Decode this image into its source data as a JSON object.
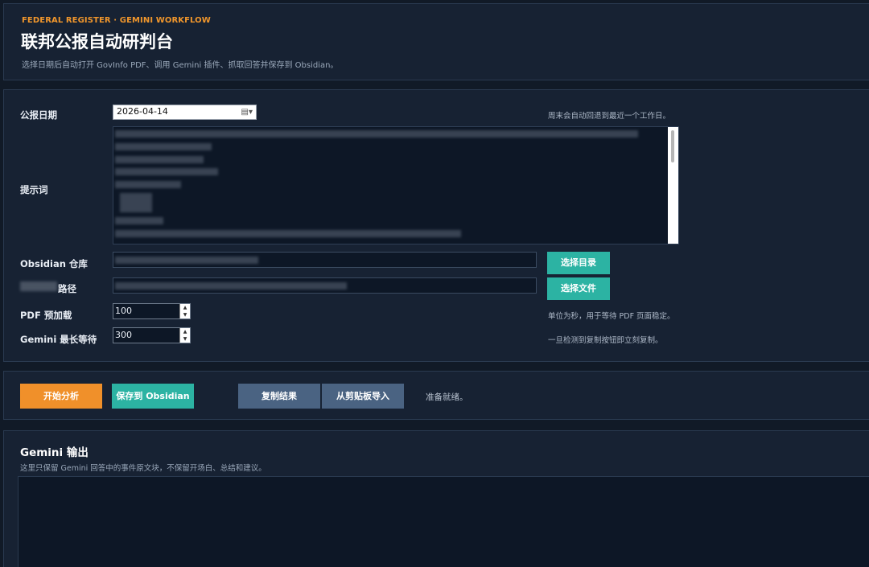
{
  "header": {
    "eyebrow": "FEDERAL REGISTER · GEMINI WORKFLOW",
    "title": "联邦公报自动研判台",
    "subtitle": "选择日期后自动打开 GovInfo PDF、调用 Gemini 插件、抓取回答并保存到 Obsidian。"
  },
  "form": {
    "date_label": "公报日期",
    "date_value": "2026-04-14",
    "date_hint": "周末会自动回退到最近一个工作日。",
    "prompt_label": "提示词",
    "vault_label": "Obsidian 仓库",
    "path_label_suffix": "路径",
    "choose_dir_label": "选择目录",
    "choose_file_label": "选择文件",
    "pdf_preload_label": "PDF 预加载",
    "pdf_preload_value": "100",
    "pdf_preload_hint": "单位为秒，用于等待 PDF 页面稳定。",
    "gemini_wait_label": "Gemini 最长等待",
    "gemini_wait_value": "300",
    "gemini_wait_hint": "一旦检测到复制按钮即立刻复制。"
  },
  "actions": {
    "start_label": "开始分析",
    "save_label": "保存到 Obsidian",
    "copy_label": "复制结果",
    "import_label": "从剪贴板导入",
    "status": "准备就绪。"
  },
  "output": {
    "title": "Gemini 输出",
    "subtitle": "这里只保留 Gemini 回答中的事件原文块，不保留开场白、总结和建议。"
  },
  "colors": {
    "accent_orange": "#f0902a",
    "accent_teal": "#2cb3a3",
    "button_slate": "#4a6382",
    "panel_bg": "#172233",
    "page_bg": "#111a27"
  }
}
